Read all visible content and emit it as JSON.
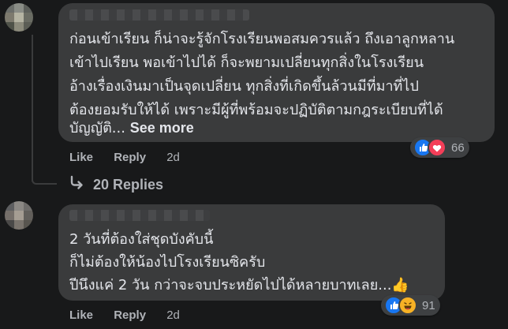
{
  "comments": [
    {
      "text_lines": [
        "ก่อนเข้าเรียน ก็น่าจะรู้จักโรงเรียนพอสมควรแล้ว ถึงเอาลูกหลาน",
        "เข้าไปเรียน พอเข้าไปได้ ก็จะพยามเปลี่ยนทุกสิ่งในโรงเรียน",
        "อ้างเรื่องเงินมาเป็นจุดเปลี่ยน ทุกสิ่งที่เกิดขึ้นล้วนมีที่มาที่ไป",
        "ต้องยอมรับให้ได้ เพราะมีผู้ที่พร้อมจะปฏิบัติตามกฎระเบียบที่ได้",
        "บัญญัติ..."
      ],
      "see_more": "See more",
      "like": "Like",
      "reply": "Reply",
      "time": "2d",
      "reaction_count": "66",
      "reaction_icons": [
        "like-icon",
        "love-icon"
      ],
      "replies_label": "20 Replies"
    },
    {
      "text_lines": [
        "2 วันที่ต้องใส่ชุดบังคับนี้",
        "ก็ไม่ต้องให้น้องไปโรงเรียนซิครับ",
        "ปีนึงแค่ 2 วัน กว่าจะจบประหยัดไปได้หลายบาทเลย...👍"
      ],
      "like": "Like",
      "reply": "Reply",
      "time": "2d",
      "reaction_count": "91",
      "reaction_icons": [
        "like-icon",
        "haha-icon"
      ]
    }
  ],
  "colors": {
    "background": "#18191a",
    "bubble": "#3a3b3c",
    "text": "#e4e6eb",
    "muted": "#b0b3b8",
    "like_blue": "#1877f2",
    "love_red": "#f33e58",
    "haha_yellow": "#f7b125"
  }
}
